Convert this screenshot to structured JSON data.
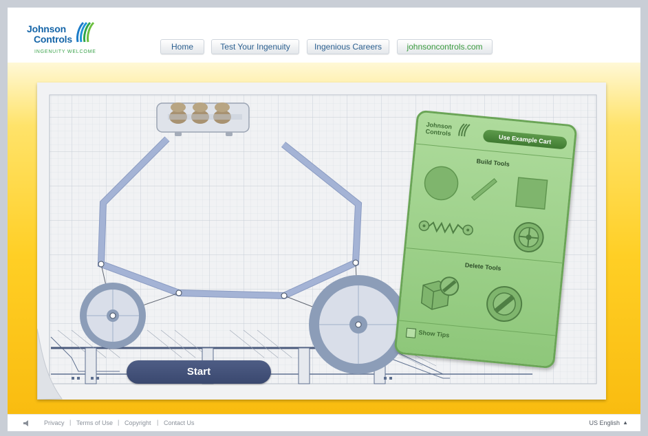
{
  "header": {
    "logo": {
      "line1": "Johnson",
      "line2": "Controls",
      "tagline": "INGENUITY WELCOME"
    },
    "nav": [
      {
        "label": "Home"
      },
      {
        "label": "Test Your Ingenuity"
      },
      {
        "label": "Ingenious Careers"
      },
      {
        "label": "johnsoncontrols.com"
      }
    ]
  },
  "game": {
    "start_label": "Start",
    "toolbox": {
      "logo_line1": "Johnson",
      "logo_line2": "Controls",
      "example_button": "Use Example Cart",
      "build_heading": "Build Tools",
      "delete_heading": "Delete Tools",
      "show_tips_label": "Show Tips",
      "show_tips_checked": false,
      "build_tools": [
        "wheel-tool",
        "beam-tool",
        "block-tool",
        "spring-tool",
        "motor-tool"
      ],
      "delete_tools": [
        "delete-block-tool",
        "delete-wheel-tool"
      ]
    }
  },
  "footer": {
    "links": [
      {
        "label": "Privacy"
      },
      {
        "label": "Terms of Use"
      },
      {
        "label": "Copyright"
      },
      {
        "label": "Contact Us"
      }
    ],
    "language": "US English"
  },
  "colors": {
    "accent_blue": "#1565a8",
    "accent_green": "#3aa24a",
    "stage_yellow": "#ffcf25",
    "toolbox_green": "#9fd18c",
    "cart_beam": "#a4b3d5",
    "wheel_ring": "#8c9db8",
    "start_button": "#3f4c72"
  }
}
